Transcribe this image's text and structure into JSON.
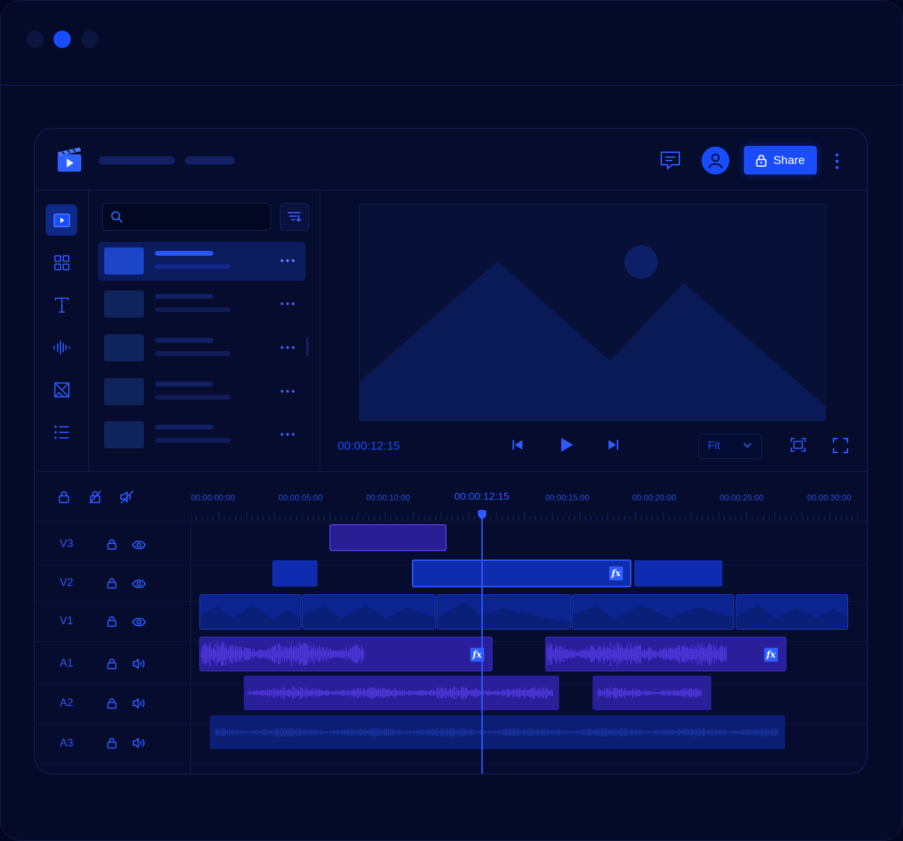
{
  "header": {
    "share_label": "Share"
  },
  "preview": {
    "timecode": "00:00:12:15",
    "zoom": "Fit"
  },
  "timeline": {
    "ruler": [
      "00:00:00:00",
      "00:00:05:00",
      "00:00:10:00",
      "00:00:12:15",
      "00:00:15:00",
      "00:00:20:00",
      "00:00:25:00",
      "00:00:30:00"
    ],
    "tracks": [
      "V3",
      "V2",
      "V1",
      "A1",
      "A2",
      "A3"
    ],
    "fx_label": "fx"
  },
  "colors": {
    "accent": "#1a4cff",
    "background": "#040a28",
    "audio_clip": "#2b1e9a",
    "video_clip": "#0f2bb0"
  },
  "icons": {
    "logo": "clapperboard-play-icon",
    "comment": "comment-icon",
    "user": "user-icon",
    "lock": "lock-icon",
    "more": "more-vertical-icon"
  }
}
